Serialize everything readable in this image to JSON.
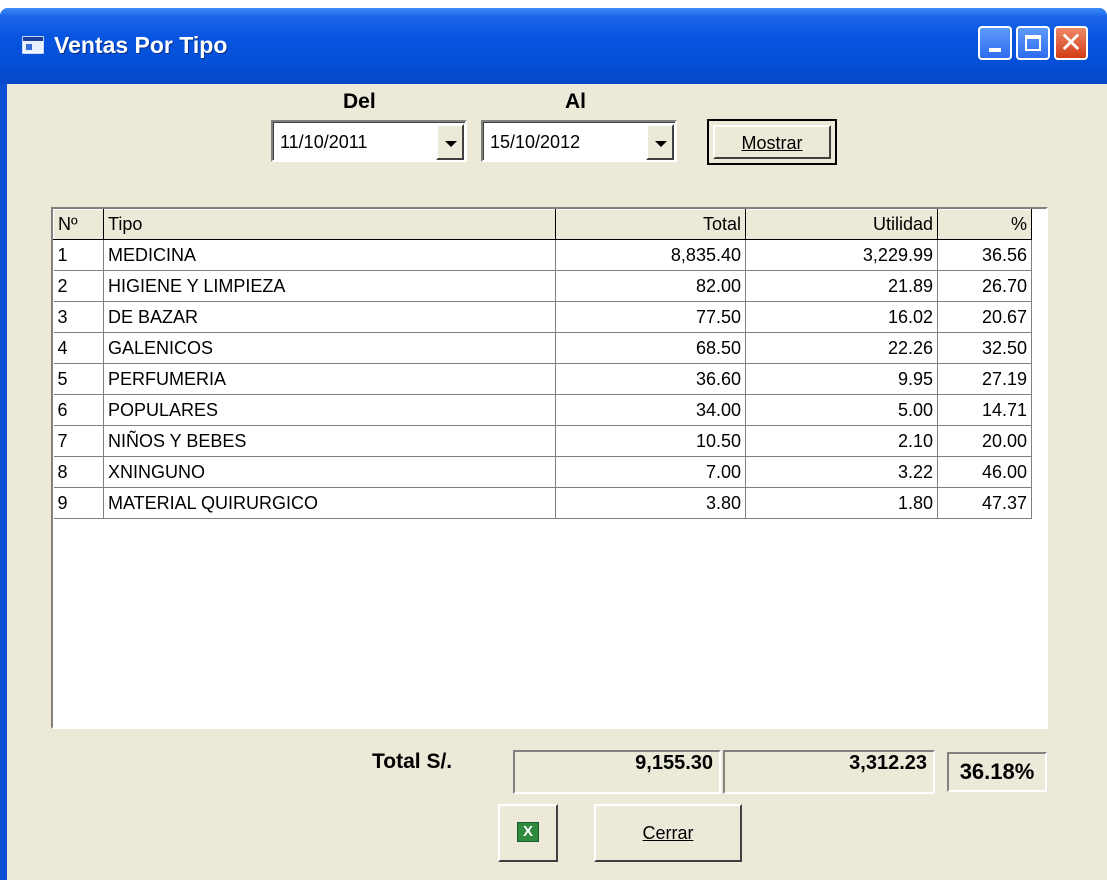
{
  "window": {
    "title": "Ventas Por Tipo"
  },
  "filters": {
    "del_label": "Del",
    "al_label": "Al",
    "del_value": "11/10/2011",
    "al_value": "15/10/2012",
    "mostrar_label": "Mostrar"
  },
  "table": {
    "headers": [
      "Nº",
      "Tipo",
      "Total",
      "Utilidad",
      "%"
    ],
    "rows": [
      [
        "1",
        "MEDICINA",
        "8,835.40",
        "3,229.99",
        "36.56"
      ],
      [
        "2",
        "HIGIENE Y LIMPIEZA",
        "82.00",
        "21.89",
        "26.70"
      ],
      [
        "3",
        "DE BAZAR",
        "77.50",
        "16.02",
        "20.67"
      ],
      [
        "4",
        "GALENICOS",
        "68.50",
        "22.26",
        "32.50"
      ],
      [
        "5",
        "PERFUMERIA",
        "36.60",
        "9.95",
        "27.19"
      ],
      [
        "6",
        "POPULARES",
        "34.00",
        "5.00",
        "14.71"
      ],
      [
        "7",
        "NIÑOS Y BEBES",
        "10.50",
        "2.10",
        "20.00"
      ],
      [
        "8",
        "XNINGUNO",
        "7.00",
        "3.22",
        "46.00"
      ],
      [
        "9",
        "MATERIAL QUIRURGICO",
        "3.80",
        "1.80",
        "47.37"
      ]
    ]
  },
  "totals": {
    "label": "Total S/.",
    "total": "9,155.30",
    "utilidad": "3,312.23",
    "percent": "36.18%"
  },
  "buttons": {
    "excel_icon": "excel-icon",
    "excel_glyph": "X",
    "cerrar_label": "Cerrar"
  }
}
